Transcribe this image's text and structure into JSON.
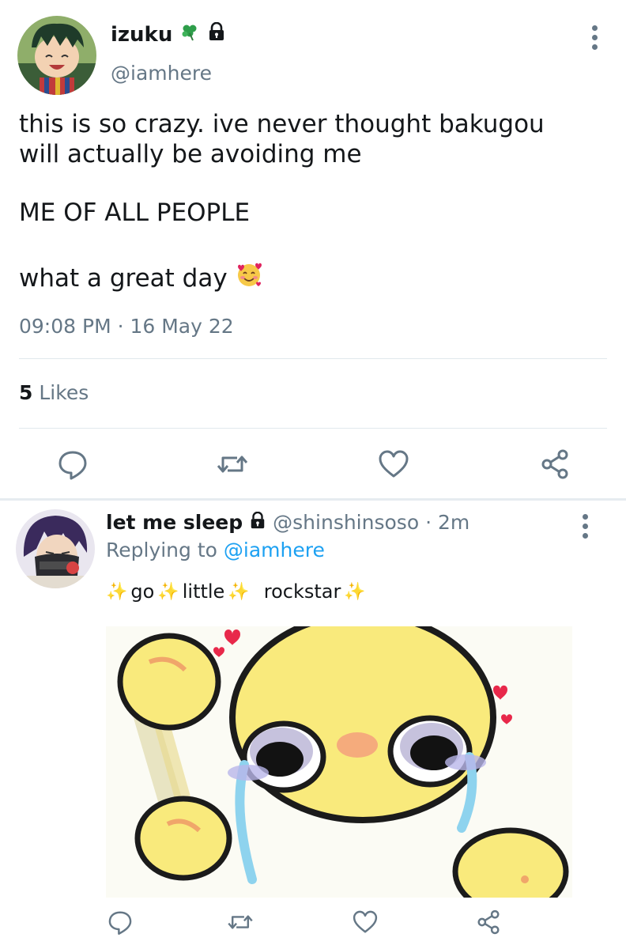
{
  "main_tweet": {
    "author_name": "izuku",
    "author_handle": "@iamhere",
    "text_line1": "this is so crazy. ive never thought bakugou",
    "text_line2": "will actually be avoiding me",
    "text_line3": "ME OF ALL PEOPLE",
    "text_line4": "what a great day",
    "timestamp": "09:08 PM · 16 May 22",
    "likes_count": "5",
    "likes_label": "Likes"
  },
  "reply": {
    "author_name": "let me sleep",
    "author_handle": "@shinshinsoso · 2m",
    "replying_prefix": "Replying to",
    "replying_mention": "@iamhere",
    "words": [
      "go",
      "little",
      "rockstar"
    ]
  },
  "icons": {
    "badge": "shamrock-icon",
    "protected": "lock-icon",
    "more": "more-vertical-icon",
    "reply": "reply-icon",
    "retweet": "retweet-icon",
    "like": "heart-icon",
    "share": "share-icon",
    "emoji": "smiling-face-with-hearts-icon",
    "sparkle": "sparkles-icon"
  },
  "colors": {
    "text": "#14171a",
    "secondary": "#657786",
    "link": "#1da1f2",
    "divider": "#e1e8ed"
  }
}
